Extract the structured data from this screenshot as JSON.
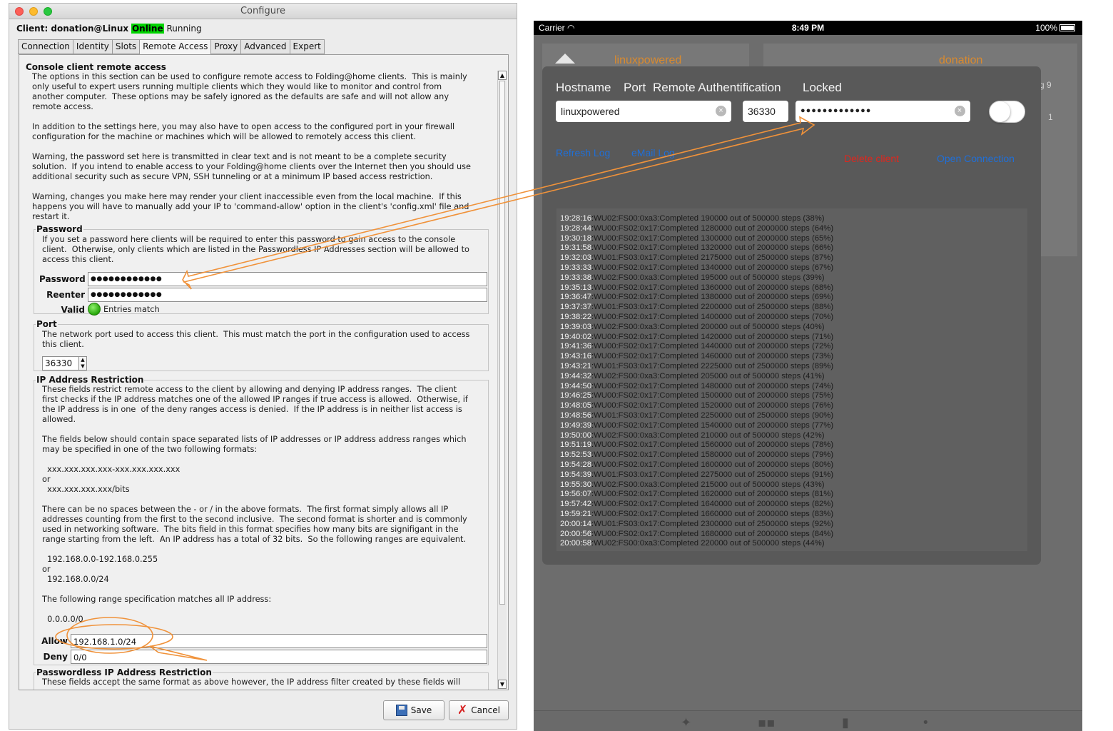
{
  "configure": {
    "window_title": "Configure",
    "client_prefix": "Client: donation@Linux",
    "online_label": "Online",
    "running_label": "Running",
    "tabs": [
      "Connection",
      "Identity",
      "Slots",
      "Remote Access",
      "Proxy",
      "Advanced",
      "Expert"
    ],
    "active_tab": "Remote Access",
    "sections": {
      "console_title": "Console client remote access",
      "console_text": "The options in this section can be used to configure remote access to Folding@home clients.  This is mainly\nonly useful to expert users running multiple clients which they would like to monitor and control from\nanother computer.  These options may be safely ignored as the defaults are safe and will not allow any\nremote access.\n\nIn addition to the settings here, you may also have to open access to the configured port in your firewall\nconfiguration for the machine or machines which will be allowed to remotely access this client.\n\nWarning, the password set here is transmitted in clear text and is not meant to be a complete security\nsolution.  If you intend to enable access to your Folding@home clients over the Internet then you should use\nadditional security such as secure VPN, SSH tunneling or at a minimum IP based access restriction.\n\nWarning, changes you make here may render your client inaccessible even from the local machine.  If this\nhappens you will have to manually add your IP to 'command-allow' option in the client's 'config.xml' file and\nrestart it.",
      "password_title": "Password",
      "password_text": "If you set a password here clients will be required to enter this password to gain access to the console\nclient.  Otherwise, only clients which are listed in the Passwordless IP Addresses section will be allowed to\naccess this client.",
      "password_label": "Password",
      "password_value": "●●●●●●●●●●●●",
      "reenter_label": "Reenter",
      "reenter_value": "●●●●●●●●●●●●",
      "valid_label": "Valid",
      "valid_text": "Entries match",
      "port_title": "Port",
      "port_text": "The network port used to access this client.  This must match the port in the configuration used to access\nthis client.",
      "port_value": "36330",
      "ip_title": "IP Address Restriction",
      "ip_text": "These fields restrict remote access to the client by allowing and denying IP address ranges.  The client\nfirst checks if the IP address matches one of the allowed IP ranges if true access is allowed.  Otherwise, if\nthe IP address is in one  of the deny ranges access is denied.  If the IP address is in neither list access is\nallowed.\n\nThe fields below should contain space separated lists of IP addresses or IP address address ranges which\nmay be specified in one of the two following formats:\n\n  xxx.xxx.xxx.xxx-xxx.xxx.xxx.xxx\nor\n  xxx.xxx.xxx.xxx/bits\n\nThere can be no spaces between the - or / in the above formats.  The first format simply allows all IP\naddresses counting from the first to the second inclusive.  The second format is shorter and is commonly\nused in networking software.  The bits field in this format specifies how many bits are signifigant in the\nrange starting from the left.  An IP address has a total of 32 bits.  So the following ranges are equivalent.\n\n  192.168.0.0-192.168.0.255\nor\n  192.168.0.0/24\n\nThe following range specification matches all IP address:\n\n  0.0.0.0/0",
      "allow_label": "Allow",
      "allow_value": "192.168.1.0/24",
      "deny_label": "Deny",
      "deny_value": "0/0",
      "passwordless_title": "Passwordless IP Address Restriction",
      "passwordless_text": "These fields accept the same format as above however, the IP address filter created by these fields will"
    },
    "save_label": "Save",
    "cancel_label": "Cancel"
  },
  "ipad": {
    "carrier": "Carrier",
    "time": "8:49 PM",
    "battery": "100%",
    "bg_titles": [
      "linuxpowered",
      "donation"
    ],
    "bg_fragments": [
      "g 9",
      "1"
    ],
    "headers": {
      "hostname": "Hostname",
      "port": "Port",
      "auth": "Remote Authentification",
      "locked": "Locked"
    },
    "hostname_value": "linuxpowered",
    "port_value": "36330",
    "auth_value": "●●●●●●●●●●●●●",
    "locked_on": false,
    "links": {
      "refresh": "Refresh Log",
      "email": "eMail Log",
      "delete": "Delete client",
      "open": "Open Connection"
    },
    "log": [
      {
        "t": "19:28:16",
        "m": "WU02:FS00:0xa3:Completed 190000 out of 500000 steps  (38%)"
      },
      {
        "t": "19:28:44",
        "m": "WU00:FS02:0x17:Completed 1280000 out of 2000000 steps (64%)"
      },
      {
        "t": "19:30:18",
        "m": "WU00:FS02:0x17:Completed 1300000 out of 2000000 steps (65%)"
      },
      {
        "t": "19:31:58",
        "m": "WU00:FS02:0x17:Completed 1320000 out of 2000000 steps (66%)"
      },
      {
        "t": "19:32:03",
        "m": "WU01:FS03:0x17:Completed 2175000 out of 2500000 steps (87%)"
      },
      {
        "t": "19:33:33",
        "m": "WU00:FS02:0x17:Completed 1340000 out of 2000000 steps (67%)"
      },
      {
        "t": "19:33:38",
        "m": "WU02:FS00:0xa3:Completed 195000 out of 500000 steps  (39%)"
      },
      {
        "t": "19:35:13",
        "m": "WU00:FS02:0x17:Completed 1360000 out of 2000000 steps (68%)"
      },
      {
        "t": "19:36:47",
        "m": "WU00:FS02:0x17:Completed 1380000 out of 2000000 steps (69%)"
      },
      {
        "t": "19:37:37",
        "m": "WU01:FS03:0x17:Completed 2200000 out of 2500000 steps (88%)"
      },
      {
        "t": "19:38:22",
        "m": "WU00:FS02:0x17:Completed 1400000 out of 2000000 steps (70%)"
      },
      {
        "t": "19:39:03",
        "m": "WU02:FS00:0xa3:Completed 200000 out of 500000 steps  (40%)"
      },
      {
        "t": "19:40:02",
        "m": "WU00:FS02:0x17:Completed 1420000 out of 2000000 steps (71%)"
      },
      {
        "t": "19:41:36",
        "m": "WU00:FS02:0x17:Completed 1440000 out of 2000000 steps (72%)"
      },
      {
        "t": "19:43:16",
        "m": "WU00:FS02:0x17:Completed 1460000 out of 2000000 steps (73%)"
      },
      {
        "t": "19:43:21",
        "m": "WU01:FS03:0x17:Completed 2225000 out of 2500000 steps (89%)"
      },
      {
        "t": "19:44:32",
        "m": "WU02:FS00:0xa3:Completed 205000 out of 500000 steps  (41%)"
      },
      {
        "t": "19:44:50",
        "m": "WU00:FS02:0x17:Completed 1480000 out of 2000000 steps (74%)"
      },
      {
        "t": "19:46:25",
        "m": "WU00:FS02:0x17:Completed 1500000 out of 2000000 steps (75%)"
      },
      {
        "t": "19:48:05",
        "m": "WU00:FS02:0x17:Completed 1520000 out of 2000000 steps (76%)"
      },
      {
        "t": "19:48:56",
        "m": "WU01:FS03:0x17:Completed 2250000 out of 2500000 steps (90%)"
      },
      {
        "t": "19:49:39",
        "m": "WU00:FS02:0x17:Completed 1540000 out of 2000000 steps (77%)"
      },
      {
        "t": "19:50:00",
        "m": "WU02:FS00:0xa3:Completed 210000 out of 500000 steps  (42%)"
      },
      {
        "t": "19:51:19",
        "m": "WU00:FS02:0x17:Completed 1560000 out of 2000000 steps (78%)"
      },
      {
        "t": "19:52:53",
        "m": "WU00:FS02:0x17:Completed 1580000 out of 2000000 steps (79%)"
      },
      {
        "t": "19:54:28",
        "m": "WU00:FS02:0x17:Completed 1600000 out of 2000000 steps (80%)"
      },
      {
        "t": "19:54:39",
        "m": "WU01:FS03:0x17:Completed 2275000 out of 2500000 steps (91%)"
      },
      {
        "t": "19:55:30",
        "m": "WU02:FS00:0xa3:Completed 215000 out of 500000 steps  (43%)"
      },
      {
        "t": "19:56:07",
        "m": "WU00:FS02:0x17:Completed 1620000 out of 2000000 steps (81%)"
      },
      {
        "t": "19:57:42",
        "m": "WU00:FS02:0x17:Completed 1640000 out of 2000000 steps (82%)"
      },
      {
        "t": "19:59:21",
        "m": "WU00:FS02:0x17:Completed 1660000 out of 2000000 steps (83%)"
      },
      {
        "t": "20:00:14",
        "m": "WU01:FS03:0x17:Completed 2300000 out of 2500000 steps (92%)"
      },
      {
        "t": "20:00:56",
        "m": "WU00:FS02:0x17:Completed 1680000 out of 2000000 steps (84%)"
      },
      {
        "t": "20:00:58",
        "m": "WU02:FS00:0xa3:Completed 220000 out of 500000 steps  (44%)"
      }
    ],
    "tabbar_icons": [
      "puzzle-icon",
      "network-icon",
      "chart-icon",
      "more-icon"
    ]
  },
  "colors": {
    "online": "#00d400",
    "orange_accent": "#d98a2f",
    "annotation": "#f0923a",
    "link_blue": "#1f6fd8",
    "delete_red": "#e0261d"
  }
}
